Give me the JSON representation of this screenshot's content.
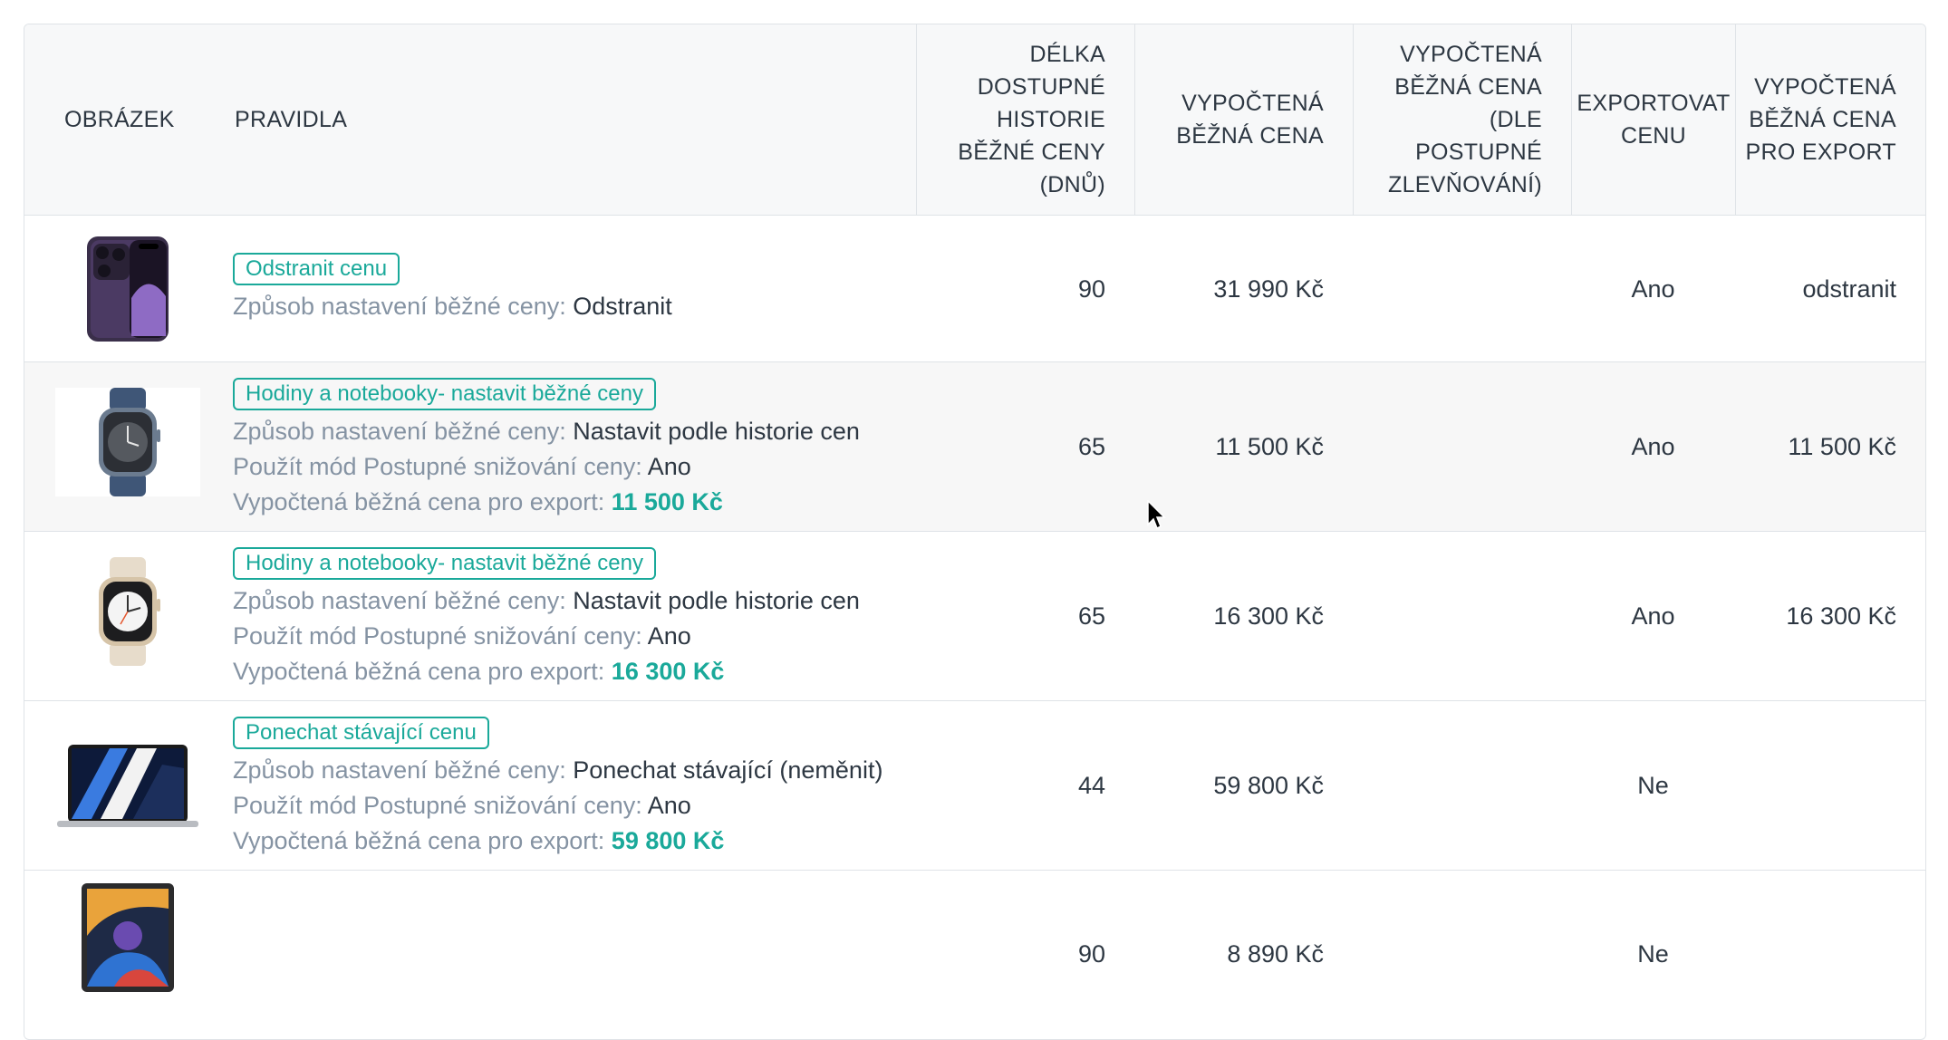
{
  "headers": {
    "obrazek": "OBRÁZEK",
    "pravidla": "PRAVIDLA",
    "delka": [
      "DÉLKA",
      "DOSTUPNÉ",
      "HISTORIE",
      "BĚŽNÉ CENY",
      "(DNŮ)"
    ],
    "vypoctena": [
      "VYPOČTENÁ",
      "BĚŽNÁ CENA"
    ],
    "dle_postupne": [
      "VYPOČTENÁ",
      "BĚŽNÁ CENA",
      "(DLE",
      "POSTUPNÉ",
      "ZLEVŇOVÁNÍ)"
    ],
    "exportovat": [
      "EXPORTOVAT",
      "CENU"
    ],
    "pro_export": [
      "VYPOČTENÁ",
      "BĚŽNÁ CENA",
      "PRO EXPORT"
    ]
  },
  "rows": [
    {
      "product_icon": "iphone-icon",
      "tag": "Odstranit cenu",
      "lines": [
        {
          "label": "Způsob nastavení běžné ceny:",
          "value": "Odstranit"
        }
      ],
      "export_line": null,
      "days": "90",
      "price": "31 990 Kč",
      "price_gradual": "",
      "export": "Ano",
      "export_price": "odstranit"
    },
    {
      "product_icon": "watch-dark-icon",
      "tag": "Hodiny a notebooky- nastavit běžné ceny",
      "lines": [
        {
          "label": "Způsob nastavení běžné ceny:",
          "value": "Nastavit podle historie cen"
        },
        {
          "label": "Použít mód Postupné snižování ceny:",
          "value": "Ano"
        }
      ],
      "export_line": {
        "label": "Vypočtená běžná cena pro export:",
        "value": "11 500 Kč"
      },
      "days": "65",
      "price": "11 500 Kč",
      "price_gradual": "",
      "export": "Ano",
      "export_price": "11 500 Kč"
    },
    {
      "product_icon": "watch-starlight-icon",
      "tag": "Hodiny a notebooky- nastavit běžné ceny",
      "lines": [
        {
          "label": "Způsob nastavení běžné ceny:",
          "value": "Nastavit podle historie cen"
        },
        {
          "label": "Použít mód Postupné snižování ceny:",
          "value": "Ano"
        }
      ],
      "export_line": {
        "label": "Vypočtená běžná cena pro export:",
        "value": "16 300 Kč"
      },
      "days": "65",
      "price": "16 300 Kč",
      "price_gradual": "",
      "export": "Ano",
      "export_price": "16 300 Kč"
    },
    {
      "product_icon": "macbook-icon",
      "tag": "Ponechat stávající cenu",
      "lines": [
        {
          "label": "Způsob nastavení běžné ceny:",
          "value": "Ponechat stávající (neměnit)"
        },
        {
          "label": "Použít mód Postupné snižování ceny:",
          "value": "Ano"
        }
      ],
      "export_line": {
        "label": "Vypočtená běžná cena pro export:",
        "value": "59 800 Kč"
      },
      "days": "44",
      "price": "59 800 Kč",
      "price_gradual": "",
      "export": "Ne",
      "export_price": ""
    },
    {
      "product_icon": "ipad-icon",
      "tag": "",
      "lines": [],
      "export_line": null,
      "days": "90",
      "price": "8 890 Kč",
      "price_gradual": "",
      "export": "Ne",
      "export_price": ""
    }
  ],
  "colors": {
    "accent": "#1aa99a",
    "muted": "#8593a3",
    "text": "#2d3742",
    "border": "#dfe3e7"
  }
}
